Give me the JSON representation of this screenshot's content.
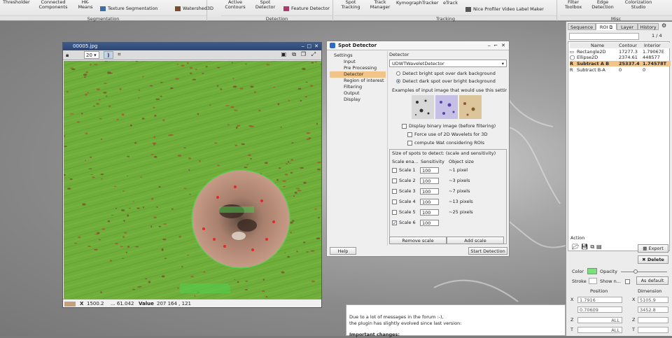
{
  "ribbon": {
    "segmentation": {
      "label": "Segmentation",
      "items": [
        "Thresholder",
        "Connected Components",
        "HK-Means",
        "Texture Segmentation",
        "Watershed3D"
      ]
    },
    "detection": {
      "label": "Detection",
      "items": [
        "Active Contours",
        "Spot Detector",
        "Feature Detector"
      ]
    },
    "tracking": {
      "label": "Tracking",
      "items": [
        "Spot Tracking",
        "Track Manager",
        "KymographTracker",
        "eTrack",
        "Nice Profiler Video Label Maker"
      ]
    },
    "misc": {
      "label": "Misc",
      "items": [
        "Filter Toolbox",
        "Edge Detection",
        "Colorization Studio"
      ]
    }
  },
  "image_window": {
    "title": "00005.jpg",
    "zoom": "20",
    "status": {
      "x_label": "X",
      "x_value": "1500.2",
      "y_value": "... 61.042",
      "value_label": "Value",
      "value": "207   164 , 121"
    }
  },
  "spot_detector": {
    "title": "Spot Detector",
    "nav": [
      "Settings",
      "Input",
      "Pre Processing",
      "Detector",
      "Region of interest",
      "Filtering",
      "Output",
      "Display"
    ],
    "selected_nav": "Detector",
    "detector_label": "Detector",
    "detector_value": "UDWTWaveletDetector",
    "options": {
      "bright": "Detect bright spot over dark background",
      "dark": "Detect dark spot over bright background",
      "examples": "Examples of input image that would use this setting"
    },
    "checks": {
      "binary": "Display binary image (before filtering)",
      "force2d": "Force use of 2D Wavelets for 3D",
      "wat": "compute Wat considering ROIs"
    },
    "scale_box": {
      "title": "Size of spots to detect: (scale and sensitivity)",
      "headers": [
        "Scale ena...",
        "Sensitivity",
        "Object size"
      ],
      "rows": [
        {
          "label": "Scale 1",
          "sens": "100",
          "size": "~1 pixel",
          "on": false
        },
        {
          "label": "Scale 2",
          "sens": "100",
          "size": "~3 pixels",
          "on": false
        },
        {
          "label": "Scale 3",
          "sens": "100",
          "size": "~7 pixels",
          "on": false
        },
        {
          "label": "Scale 4",
          "sens": "100",
          "size": "~13 pixels",
          "on": false
        },
        {
          "label": "Scale 5",
          "sens": "100",
          "size": "~25 pixels",
          "on": false
        },
        {
          "label": "Scale 6",
          "sens": "100",
          "size": "",
          "on": true
        }
      ]
    },
    "buttons": {
      "remove_scale": "Remove scale",
      "add_scale": "Add scale",
      "help": "Help",
      "start": "Start Detection"
    }
  },
  "text_panel": {
    "lines": [
      "Due to a lot of messages in the forum :-),",
      "the plugin has slightly evolved since last version:"
    ],
    "bold_line": "Important changes:"
  },
  "right_panel": {
    "tabs": [
      "Sequence",
      "ROI",
      "Layer",
      "History"
    ],
    "count": "1 / 4",
    "roi_headers": [
      "Name",
      "Contour",
      "Interior"
    ],
    "rois": [
      {
        "name": "Rectangle2D",
        "contour": "17277.3",
        "interior": "1.79067E"
      },
      {
        "name": "Ellipse2D",
        "contour": "2374.61",
        "interior": "448577"
      },
      {
        "name": "Subtract A B",
        "contour": "25337.4",
        "interior": "1.74578T"
      },
      {
        "name": "Subtract B-A",
        "contour": "0",
        "interior": "0"
      }
    ],
    "action_label": "Action",
    "export_label": "Export",
    "delete_label": "Delete",
    "color_label": "Color",
    "opacity_label": "Opacity",
    "stroke_label": "Stroke",
    "show_label": "Show n...",
    "as_default": "As default",
    "position_label": "Position",
    "dimension_label": "Dimension",
    "pos_x": "1.7916",
    "pos_y": "0.70609",
    "dim_x": "5105.9",
    "dim_y": "3452.8",
    "all": "ALL",
    "colors": {
      "roi_fill": "#7ce07c"
    }
  }
}
